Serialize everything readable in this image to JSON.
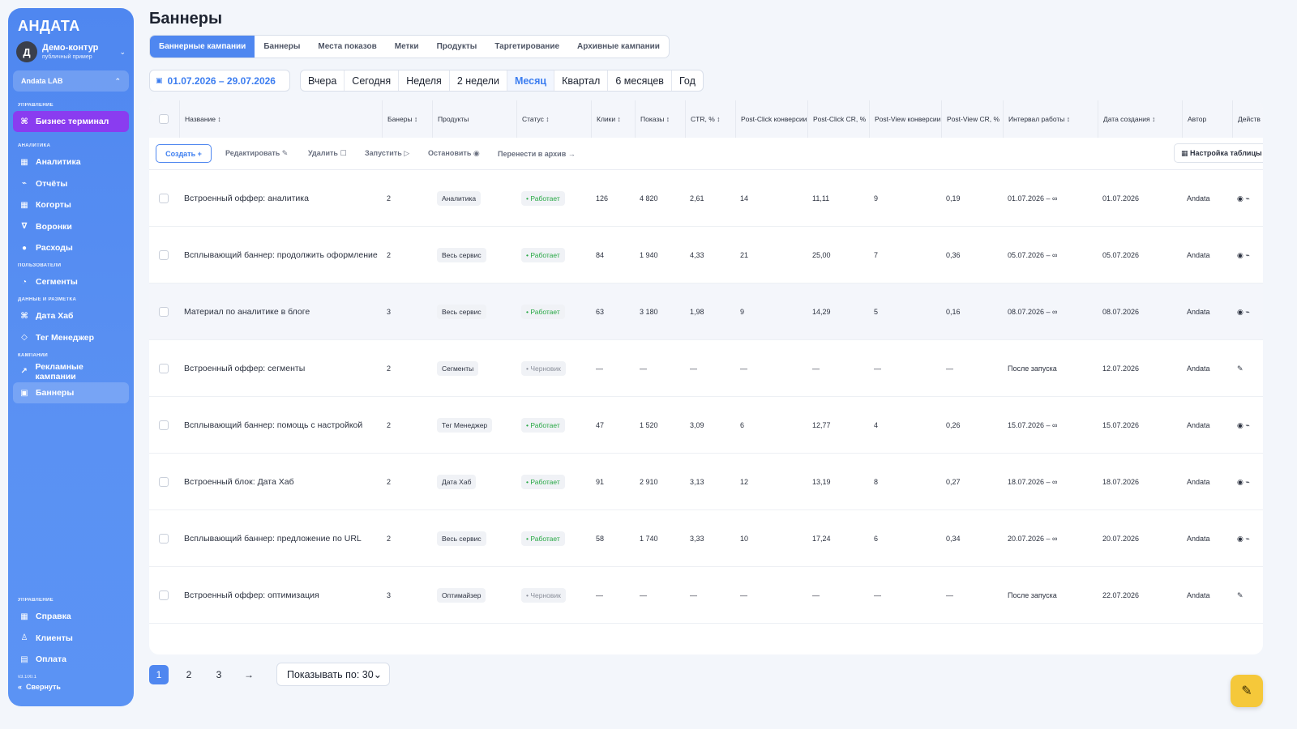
{
  "sidebar": {
    "brand": "АНДАТА",
    "avatar_letter": "Д",
    "account_name": "Демо-контур",
    "account_sub": "публичный пример",
    "org": "Andata LAB",
    "sections": {
      "manage": "УПРАВЛЕНИЕ",
      "analytics": "АНАЛИТИКА",
      "users": "ПОЛЬЗОВАТЕЛИ",
      "data": "ДАННЫЕ И РАЗМЕТКА",
      "campaigns": "КАМПАНИИ",
      "bottom": "УПРАВЛЕНИЕ"
    },
    "items": {
      "terminal": "Бизнес терминал",
      "analytics": "Аналитика",
      "reports": "Отчёты",
      "cohorts": "Когорты",
      "funnels": "Воронки",
      "expenses": "Расходы",
      "segments": "Сегменты",
      "datahub": "Дата Хаб",
      "tagmanager": "Тег Менеджер",
      "adcampaigns": "Рекламные кампании",
      "banners": "Баннеры",
      "help": "Справка",
      "clients": "Клиенты",
      "billing": "Оплата"
    },
    "version": "v3.100.1",
    "collapse": "Свернуть"
  },
  "page": {
    "title": "Баннеры"
  },
  "tabs": [
    "Баннерные кампании",
    "Баннеры",
    "Места показов",
    "Метки",
    "Продукты",
    "Таргетирование",
    "Архивные кампании"
  ],
  "date_range": "01.07.2026 – 29.07.2026",
  "periods": [
    "Вчера",
    "Сегодня",
    "Неделя",
    "2 недели",
    "Месяц",
    "Квартал",
    "6 месяцев",
    "Год"
  ],
  "table": {
    "headers": {
      "name": "Название ↕",
      "banners": "Банеры ↕",
      "products": "Продукты",
      "status": "Статус ↕",
      "clicks": "Клики ↕",
      "shows": "Показы ↕",
      "ctr": "CTR, % ↕",
      "pc_conv": "Post-Click конверсии",
      "pc_cr": "Post-Click CR, %",
      "pv_conv": "Post-View конверсии",
      "pv_cr": "Post-View CR, %",
      "interval": "Интервал работы ↕",
      "created": "Дата создания ↕",
      "author": "Автор",
      "actions": "Действ"
    },
    "toolbar": {
      "create": "Создать +",
      "edit": "Редактировать ✎",
      "delete": "Удалить ☐",
      "start": "Запустить ▷",
      "stop": "Остановить ◉",
      "archive": "Перенести в архив →",
      "settings": "▦ Настройка таблицы"
    },
    "rows": [
      {
        "name": "Встроенный оффер: аналитика",
        "banners": "2",
        "product": "Аналитика",
        "status": "• Работает",
        "kind": "ok",
        "clicks": "126",
        "shows": "4 820",
        "ctr": "2,61",
        "pc_conv": "14",
        "pc_cr": "11,11",
        "pv_conv": "9",
        "pv_cr": "0,19",
        "interval": "01.07.2026 – ∞",
        "created": "01.07.2026",
        "author": "Andata",
        "action": "◉ ⌁"
      },
      {
        "name": "Всплывающий баннер: продолжить оформление",
        "banners": "2",
        "product": "Весь сервис",
        "status": "• Работает",
        "kind": "ok",
        "clicks": "84",
        "shows": "1 940",
        "ctr": "4,33",
        "pc_conv": "21",
        "pc_cr": "25,00",
        "pv_conv": "7",
        "pv_cr": "0,36",
        "interval": "05.07.2026 – ∞",
        "created": "05.07.2026",
        "author": "Andata",
        "action": "◉ ⌁"
      },
      {
        "name": "Материал по аналитике в блоге",
        "banners": "3",
        "product": "Весь сервис",
        "status": "• Работает",
        "kind": "ok",
        "clicks": "63",
        "shows": "3 180",
        "ctr": "1,98",
        "pc_conv": "9",
        "pc_cr": "14,29",
        "pv_conv": "5",
        "pv_cr": "0,16",
        "interval": "08.07.2026 – ∞",
        "created": "08.07.2026",
        "author": "Andata",
        "action": "◉ ⌁"
      },
      {
        "name": "Встроенный оффер: сегменты",
        "banners": "2",
        "product": "Сегменты",
        "status": "• Черновик",
        "kind": "draft",
        "clicks": "—",
        "shows": "—",
        "ctr": "—",
        "pc_conv": "—",
        "pc_cr": "—",
        "pv_conv": "—",
        "pv_cr": "—",
        "interval": "После запуска",
        "created": "12.07.2026",
        "author": "Andata",
        "action": "✎"
      },
      {
        "name": "Всплывающий баннер: помощь с настройкой",
        "banners": "2",
        "product": "Тег Менеджер",
        "status": "• Работает",
        "kind": "ok",
        "clicks": "47",
        "shows": "1 520",
        "ctr": "3,09",
        "pc_conv": "6",
        "pc_cr": "12,77",
        "pv_conv": "4",
        "pv_cr": "0,26",
        "interval": "15.07.2026 – ∞",
        "created": "15.07.2026",
        "author": "Andata",
        "action": "◉ ⌁"
      },
      {
        "name": "Встроенный блок: Дата Хаб",
        "banners": "2",
        "product": "Дата Хаб",
        "status": "• Работает",
        "kind": "ok",
        "clicks": "91",
        "shows": "2 910",
        "ctr": "3,13",
        "pc_conv": "12",
        "pc_cr": "13,19",
        "pv_conv": "8",
        "pv_cr": "0,27",
        "interval": "18.07.2026 – ∞",
        "created": "18.07.2026",
        "author": "Andata",
        "action": "◉ ⌁"
      },
      {
        "name": "Всплывающий баннер: предложение по URL",
        "banners": "2",
        "product": "Весь сервис",
        "status": "• Работает",
        "kind": "ok",
        "clicks": "58",
        "shows": "1 740",
        "ctr": "3,33",
        "pc_conv": "10",
        "pc_cr": "17,24",
        "pv_conv": "6",
        "pv_cr": "0,34",
        "interval": "20.07.2026 – ∞",
        "created": "20.07.2026",
        "author": "Andata",
        "action": "◉ ⌁"
      },
      {
        "name": "Встроенный оффер: оптимизация",
        "banners": "3",
        "product": "Оптимайзер",
        "status": "• Черновик",
        "kind": "draft",
        "clicks": "—",
        "shows": "—",
        "ctr": "—",
        "pc_conv": "—",
        "pc_cr": "—",
        "pv_conv": "—",
        "pv_cr": "—",
        "interval": "После запуска",
        "created": "22.07.2026",
        "author": "Andata",
        "action": "✎"
      }
    ]
  },
  "pager": {
    "pages": [
      "1",
      "2",
      "3",
      "→"
    ],
    "per_page": "Показывать по: 30⌄"
  },
  "fab_icon": "✎"
}
